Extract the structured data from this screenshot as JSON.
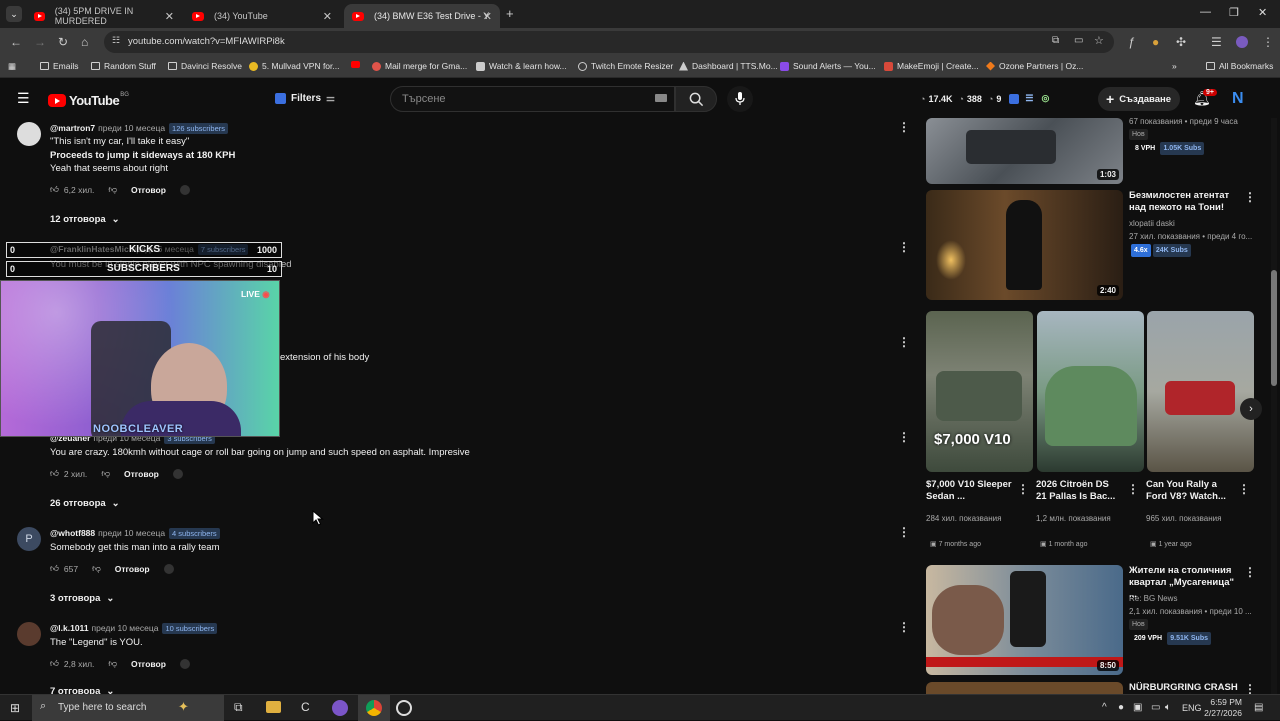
{
  "browser": {
    "tabs": [
      {
        "label": "(34) 5PM DRIVE IN MURDERED"
      },
      {
        "label": "(34) YouTube"
      },
      {
        "label": "(34) BMW E36 Test Drive - Y"
      }
    ],
    "url": "youtube.com/watch?v=MFIAWIRPi8k",
    "bookmarks": [
      "Emails",
      "Random Stuff",
      "Davinci Resolve",
      "5. Mullvad VPN for...",
      "",
      "Mail merge for Gma...",
      "Watch & learn how...",
      "Twitch Emote Resizer",
      "Dashboard | TTS.Mo...",
      "Sound Alerts — You...",
      "MakeEmoji | Create...",
      "Ozone Partners | Oz..."
    ],
    "all_bookmarks": "All Bookmarks"
  },
  "youtube": {
    "logo": "YouTube",
    "region": "BG",
    "filters": "Filters",
    "search_placeholder": "Търсене",
    "stats": {
      "a": "17.4K",
      "b": "388",
      "c": "9"
    },
    "create": "Създаване",
    "notif": "9+",
    "avatar_letter": "N"
  },
  "comments": [
    {
      "user": "@martron7",
      "time": "преди 10 месеца",
      "subs": "126 subscribers",
      "lines": [
        "\"This isn't my car, I'll take it easy\"",
        "Proceeds to jump it sideways at 180 KPH",
        "Yeah that seems about right"
      ],
      "likes": "6,2 хил.",
      "reply": "Отговор",
      "replies": "12 отговора"
    },
    {
      "user": "@FranklinHatesMic",
      "time": "преди 6 месеца",
      "subs": "7 subscribers",
      "lines": [
        "You must be in single player with NPC spawning disabled"
      ]
    },
    {
      "partial": "extension of his body"
    },
    {
      "user": "@zeuaner",
      "time": "преди 10 месеца",
      "subs": "3 subscribers",
      "lines": [
        "You are crazy. 180kmh without cage or roll bar going on jump and such speed on asphalt. Impresive"
      ],
      "likes": "2 хил.",
      "reply": "Отговор",
      "replies": "26 отговора"
    },
    {
      "user": "@whotf888",
      "time": "преди 10 месеца",
      "subs": "4 subscribers",
      "avatar": "P",
      "lines": [
        "Somebody get this man into a rally team"
      ],
      "likes": "657",
      "reply": "Отговор",
      "replies": "3 отговора"
    },
    {
      "user": "@l.k.1011",
      "time": "преди 10 месеца",
      "subs": "10 subscribers",
      "lines": [
        "The \"Legend\" is YOU."
      ],
      "likes": "2,8 хил.",
      "reply": "Отговор",
      "replies": "7 отговора"
    }
  ],
  "overlay": {
    "row1": {
      "left": "0",
      "label": "KICKS",
      "right": "1000"
    },
    "row2": {
      "left": "0",
      "label": "SUBSCRIBERS",
      "right": "10"
    },
    "live": "LIVE",
    "name": "NOOBCLEAVER"
  },
  "sidebar": {
    "v0": {
      "meta1": "67 показвания • преди 9 часа",
      "tag": "Нов",
      "vph": "8 VPH",
      "subs": "1.05K Subs",
      "dur": "1:03"
    },
    "v1": {
      "title": "Безмилостен атентат над пежото на Тони!",
      "channel": "xlopatii daski",
      "meta": "27 хил. показвания • преди 4 го...",
      "vph": "4.6x",
      "subs": "24K Subs",
      "dur": "2:40"
    },
    "shorts": [
      {
        "title": "$7,000 V10 Sleeper Sedan ...",
        "views": "284 хил. показвания",
        "ago": "7 months ago",
        "overlay": "$7,000 V10"
      },
      {
        "title": "2026 Citroën DS 21 Pallas Is Bac...",
        "views": "1,2 млн. показвания",
        "ago": "1 month ago"
      },
      {
        "title": "Can You Rally a Ford V8? Watch...",
        "views": "965 хил. показвания",
        "ago": "1 year ago"
      }
    ],
    "v2": {
      "title": "Жители на столичния квартал „Мусагеница\" ...",
      "channel": "Re: BG News",
      "meta": "2,1 хил. показвания • преди 10 ...",
      "tag": "Нов",
      "vph": "209 VPH",
      "subs": "9.51K Subs",
      "dur": "8:50"
    },
    "v3": {
      "title": "NÜRBURGRING CRASH"
    }
  },
  "taskbar": {
    "search": "Type here to search",
    "lang": "ENG",
    "time": "6:59 PM",
    "date": "2/27/2026"
  }
}
